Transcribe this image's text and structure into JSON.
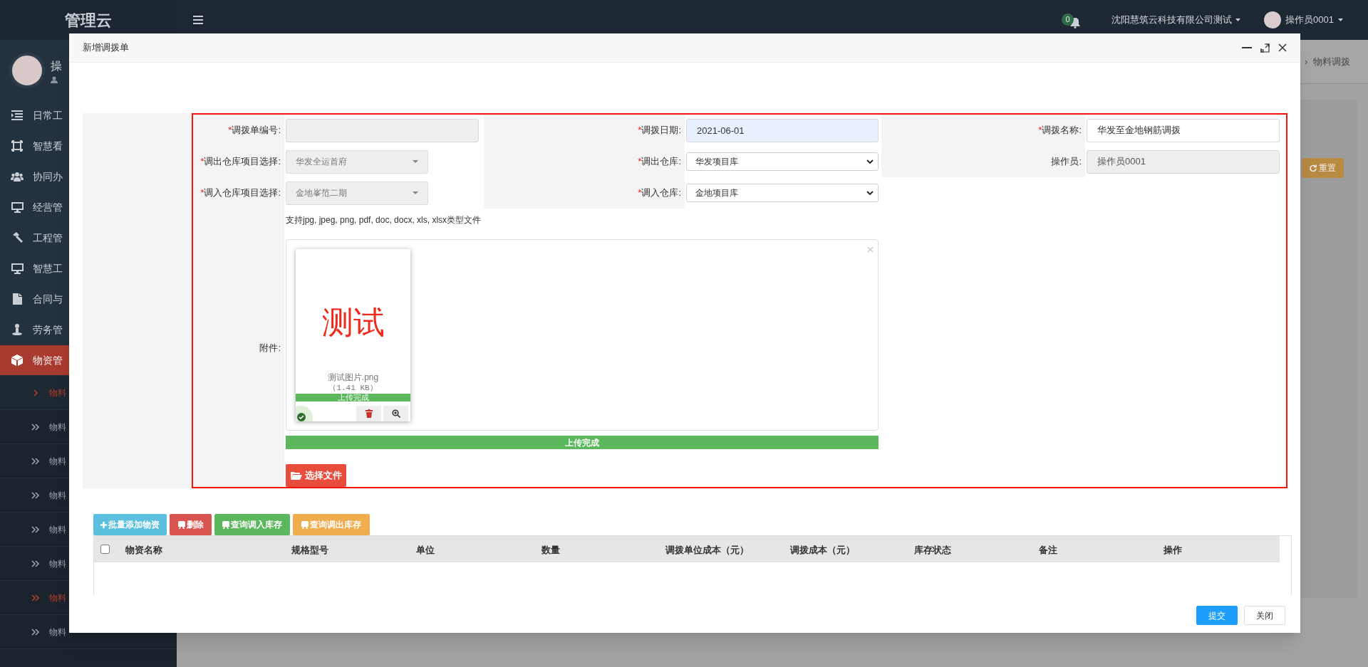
{
  "topbar": {
    "logo": "管理云",
    "notification_count": "0",
    "company": "沈阳慧筑云科技有限公司测试",
    "user": "操作员0001"
  },
  "sidebar": {
    "user_name": "操",
    "items": [
      {
        "label": "日常工",
        "selected": false
      },
      {
        "label": "智慧看",
        "selected": false
      },
      {
        "label": "协同办",
        "selected": false
      },
      {
        "label": "经营管",
        "selected": false
      },
      {
        "label": "工程管",
        "selected": false
      },
      {
        "label": "智慧工",
        "selected": false
      },
      {
        "label": "合同与",
        "selected": false
      },
      {
        "label": "劳务管",
        "selected": false
      },
      {
        "label": "物资管",
        "selected": true
      }
    ],
    "subitems": [
      {
        "label": "物料",
        "selected": true,
        "expanded": true
      },
      {
        "label": "物料",
        "selected": false,
        "expanded": false
      },
      {
        "label": "物料",
        "selected": false,
        "expanded": false
      },
      {
        "label": "物料",
        "selected": false,
        "expanded": false
      },
      {
        "label": "物料",
        "selected": false,
        "expanded": false
      },
      {
        "label": "物料",
        "selected": false,
        "expanded": false
      },
      {
        "label": "物料",
        "selected": true,
        "expanded": false
      },
      {
        "label": "物料",
        "selected": false,
        "expanded": false
      }
    ]
  },
  "background": {
    "breadcrumb_separator": "›",
    "breadcrumb": "物料调拨",
    "reset_button": "重置"
  },
  "dialog": {
    "title": "新增调拨单",
    "required_mark": "*",
    "rows": [
      [
        {
          "label": "调拨单编号:",
          "required": true,
          "kind": "text",
          "disabled": true
        },
        {
          "label": "调拨日期:",
          "required": true,
          "kind": "text",
          "value": "2021-06-01",
          "disabled": false,
          "autofill": true
        },
        {
          "label": "调拨名称:",
          "required": true,
          "kind": "text",
          "value": "华发至金地钢筋调拨",
          "disabled": false,
          "autofill": false
        }
      ],
      [
        {
          "label": "调出仓库项目选择:",
          "required": true,
          "kind": "combo",
          "value": "华发全运首府",
          "disabled": true
        },
        {
          "label": "调出仓库:",
          "required": true,
          "kind": "select",
          "value": "华发项目库",
          "disabled": false
        },
        {
          "label": "操作员:",
          "required": false,
          "kind": "text",
          "value": "操作员0001",
          "disabled": true
        }
      ],
      [
        {
          "label": "调入仓库项目选择:",
          "required": true,
          "kind": "combo",
          "value": "金地峯范二期",
          "disabled": true
        },
        {
          "label": "调入仓库:",
          "required": true,
          "kind": "select",
          "value": "金地项目库",
          "disabled": false
        }
      ]
    ],
    "attachment": {
      "label": "附件:",
      "hint": "支持jpg, jpeg, png, pdf, doc, docx, xls, xlsx类型文件",
      "files": [
        {
          "preview_text": "测试",
          "name": "测试图片.png",
          "size": "（1.41 KB）",
          "status": "上传完成",
          "level": 1,
          "uploaded": true
        }
      ],
      "progress": {
        "label": "上传完成",
        "level": 1
      },
      "choose_button": "选择文件"
    },
    "toolbar": [
      {
        "label": "批量添加物资",
        "kind": "add"
      },
      {
        "label": "删除",
        "kind": "delete"
      },
      {
        "label": "查询调入库存",
        "kind": "in"
      },
      {
        "label": "查询调出库存",
        "kind": "out"
      }
    ],
    "table": {
      "select_all_checked": false,
      "columns": [
        "物资名称",
        "规格型号",
        "单位",
        "数量",
        "调拨单位成本（元）",
        "调拨成本（元）",
        "库存状态",
        "备注",
        "操作"
      ]
    },
    "buttons": [
      {
        "label": "提交",
        "kind": "primary"
      },
      {
        "label": "关闭",
        "kind": "default"
      }
    ]
  }
}
